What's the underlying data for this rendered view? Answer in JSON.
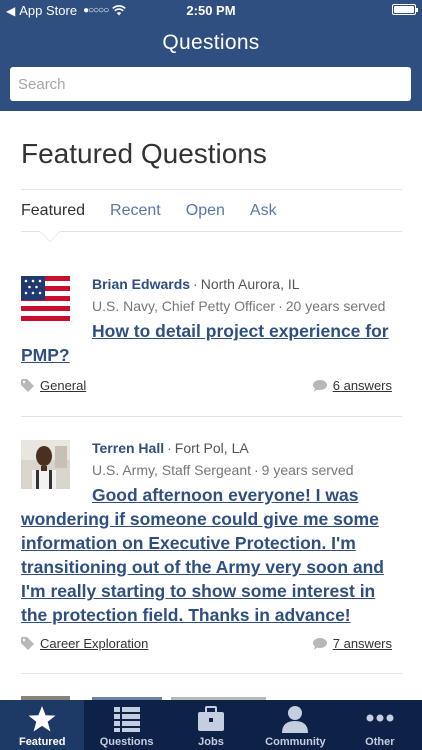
{
  "status_bar": {
    "back_label": "App Store",
    "time": "2:50 PM"
  },
  "nav": {
    "title": "Questions"
  },
  "search": {
    "placeholder": "Search"
  },
  "page": {
    "title": "Featured Questions"
  },
  "tabs": [
    {
      "label": "Featured",
      "active": true
    },
    {
      "label": "Recent",
      "active": false
    },
    {
      "label": "Open",
      "active": false
    },
    {
      "label": "Ask",
      "active": false
    }
  ],
  "questions": [
    {
      "name": "Brian Edwards",
      "location": "North Aurora, IL",
      "service": "U.S. Navy, Chief Petty Officer",
      "years": "20 years served",
      "question": "How to detail project experience for PMP?",
      "tag": "General",
      "answers": "6 answers"
    },
    {
      "name": "Terren Hall",
      "location": "Fort Pol, LA",
      "service": "U.S. Army, Staff Sergeant",
      "years": "9 years served",
      "question": "Good afternoon everyone! I was wondering if someone could give me some information on Executive Protection. I'm transitioning out of the Army very soon and I'm really starting to show some interest in the protection field. Thanks in advance!",
      "tag": "Career Exploration",
      "answers": "7 answers"
    }
  ],
  "tab_bar": [
    {
      "label": "Featured",
      "icon": "star-icon",
      "selected": true
    },
    {
      "label": "Questions",
      "icon": "list-icon",
      "selected": false
    },
    {
      "label": "Jobs",
      "icon": "briefcase-icon",
      "selected": false
    },
    {
      "label": "Community",
      "icon": "person-icon",
      "selected": false
    },
    {
      "label": "Other",
      "icon": "more-icon",
      "selected": false
    }
  ],
  "colors": {
    "header": "#2f4f80",
    "accent_link": "#2f4f80",
    "tab_bar": "#0e2248",
    "tab_bar_selected": "#1d3966"
  }
}
